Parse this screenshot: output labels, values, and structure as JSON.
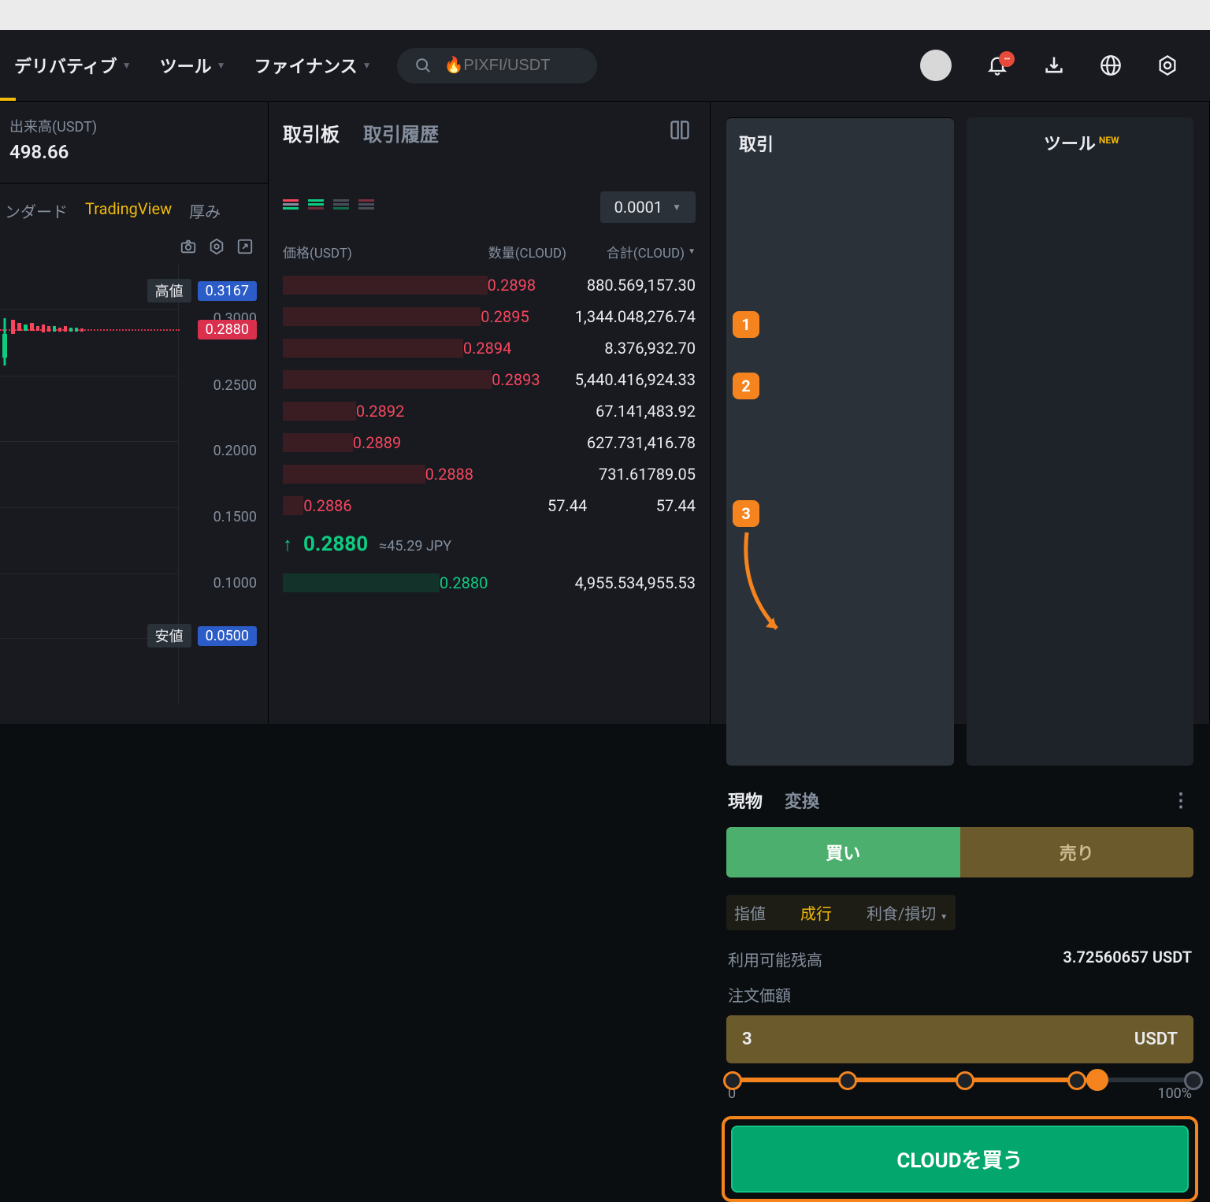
{
  "nav": {
    "items": [
      "デリバティブ",
      "ツール",
      "ファイナンス"
    ],
    "search_placeholder": "🔥PIXFI/USDT"
  },
  "volume": {
    "label": "出来高(USDT)",
    "value": "498.66"
  },
  "chartTabs": [
    "ンダード",
    "TradingView",
    "厚み"
  ],
  "yaxis": {
    "t_3000": "0.3000",
    "t_2500": "0.2500",
    "t_2000": "0.2000",
    "t_1500": "0.1500",
    "t_1000": "0.1000",
    "high_label": "高値",
    "high_val": "0.3167",
    "price": "0.2880",
    "low_label": "安値",
    "low_val": "0.0500"
  },
  "orderbook": {
    "tabs": {
      "book": "取引板",
      "history": "取引履歴"
    },
    "precision": "0.0001",
    "cols": {
      "price": "価格(USDT)",
      "qty": "数量(CLOUD)",
      "total": "合計(CLOUD)"
    },
    "asks": [
      {
        "p": "0.2898",
        "q": "880.56",
        "t": "9,157.30",
        "d": 95
      },
      {
        "p": "0.2895",
        "q": "1,344.04",
        "t": "8,276.74",
        "d": 88
      },
      {
        "p": "0.2894",
        "q": "8.37",
        "t": "6,932.70",
        "d": 72
      },
      {
        "p": "0.2893",
        "q": "5,440.41",
        "t": "6,924.33",
        "d": 100
      },
      {
        "p": "0.2892",
        "q": "67.14",
        "t": "1,483.92",
        "d": 18
      },
      {
        "p": "0.2889",
        "q": "627.73",
        "t": "1,416.78",
        "d": 17
      },
      {
        "p": "0.2888",
        "q": "731.61",
        "t": "789.05",
        "d": 44
      },
      {
        "p": "0.2886",
        "q": "57.44",
        "t": "57.44",
        "d": 5
      }
    ],
    "last": "0.2880",
    "approx": "≈45.29 JPY",
    "bids": [
      {
        "p": "0.2880",
        "q": "4,955.53",
        "t": "4,955.53",
        "d": 55
      }
    ]
  },
  "trade": {
    "tabs": {
      "trade": "取引",
      "tool": "ツール",
      "new": "NEW"
    },
    "subtabs": {
      "spot": "現物",
      "convert": "変換"
    },
    "buy": "買い",
    "sell": "売り",
    "ordertypes": {
      "limit": "指値",
      "market": "成行",
      "stop": "利食/損切"
    },
    "avail_label": "利用可能残高",
    "avail_val": "3.72560657 USDT",
    "order_label": "注文価額",
    "amount": "3",
    "amount_unit": "USDT",
    "slider": {
      "min": "0",
      "max": "100%"
    },
    "buy_button": "CLOUDを買う"
  },
  "callouts": {
    "c1": "1",
    "c2": "2",
    "c3": "3"
  },
  "chart_data": {
    "type": "candlestick-overview",
    "price_axis_ticks": [
      0.3,
      0.25,
      0.2,
      0.15,
      0.1,
      0.05
    ],
    "high": 0.3167,
    "low": 0.05,
    "last_price": 0.288,
    "note": "Candles cropped on left edge; only axis, high/low badges and last-price line visible. Individual OHLC values not legible."
  }
}
